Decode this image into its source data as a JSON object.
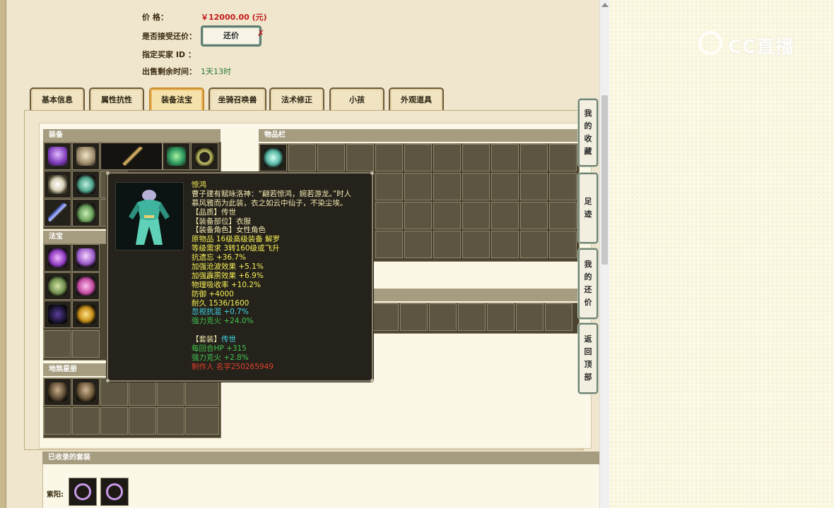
{
  "listing": {
    "price_label": "价        格：",
    "price_value": "￥12000.00 (元)",
    "accept_counter_label": "是否接受还价：",
    "counter_button": "还价",
    "counter_mark": "✗",
    "buyer_id_label": "指定买家 ID ：",
    "remaining_label": "出售剩余时间：",
    "remaining_value": "1天13时"
  },
  "tabs": [
    {
      "label": "基本信息"
    },
    {
      "label": "属性抗性"
    },
    {
      "label": "装备法宝"
    },
    {
      "label": "坐骑召唤兽"
    },
    {
      "label": "法术修正"
    },
    {
      "label": "小孩"
    },
    {
      "label": "外观道具"
    }
  ],
  "active_tab": "装备法宝",
  "sections": {
    "equipment": "装备",
    "inventory": "物品栏",
    "treasure": "法宝",
    "earth_star": "地煞星册",
    "collected_sets": "已收录的套装"
  },
  "collected_sets": {
    "row_label": "紫阳:"
  },
  "tooltip": {
    "name": "惊鸿",
    "lines": [
      {
        "text": "曹子建有赋咏洛神：“翩若惊鸿，婉若游龙。”时人",
        "color": "white"
      },
      {
        "text": "慕风雅而为此装，衣之如云中仙子，不染尘埃。",
        "color": "white"
      },
      {
        "text": "【品质】传世",
        "color": "white"
      },
      {
        "text": "【装备部位】衣服",
        "color": "white"
      },
      {
        "text": "【装备角色】女性角色",
        "color": "white"
      },
      {
        "text": "原物品 16级高级装备 解罗",
        "color": "yellow"
      },
      {
        "text": "等级需求 3转160级或飞升",
        "color": "yellow"
      },
      {
        "text": "抗遗忘 +36.7%",
        "color": "yellow"
      },
      {
        "text": "加强沧波效果 +5.1%",
        "color": "yellow"
      },
      {
        "text": "加强霹雳效果 +6.9%",
        "color": "yellow"
      },
      {
        "text": "物理吸收率 +10.2%",
        "color": "yellow"
      },
      {
        "text": "防御 +4000",
        "color": "yellow"
      },
      {
        "text": "耐久 1536/1600",
        "color": "yellow"
      },
      {
        "text": "忽视抗混 +0.7%",
        "color": "cyan"
      },
      {
        "text": "强力克火 +24.0%",
        "color": "green"
      },
      {
        "text": "",
        "color": "white"
      },
      {
        "text": "【套装】传世",
        "color": "mixed"
      },
      {
        "text": "每回合HP +315",
        "color": "green"
      },
      {
        "text": "强力克火 +2.8%",
        "color": "green"
      },
      {
        "text": "制作人 名字250265949",
        "color": "red"
      }
    ]
  },
  "side_buttons": [
    {
      "chars": [
        "我",
        "的",
        "收",
        "藏"
      ]
    },
    {
      "chars": [
        "足",
        "迹"
      ]
    },
    {
      "chars": [
        "我",
        "的",
        "还",
        "价"
      ]
    },
    {
      "chars": [
        "返",
        "回",
        "顶",
        "部"
      ]
    }
  ],
  "watermark": "CC直播",
  "icons": {
    "equipment_items": [
      "jellyfish-helm-icon",
      "skull-hat-icon",
      "whip-weapon-icon",
      "feather-mask-icon",
      "bead-necklace-icon",
      "white-flower-icon",
      "jade-dress-icon",
      "green-boots-icon",
      "sword-icon"
    ],
    "inventory_items": [
      "jade-bracelet-icon"
    ],
    "treasure_items": [
      "purple-cube-icon",
      "lantern-icon",
      "cactus-icon",
      "pink-lamp-icon",
      "dark-orb-icon",
      "golden-pillar-icon"
    ],
    "earth_star_items": [
      "warrior-portrait-icon",
      "monk-portrait-icon"
    ],
    "set_items": [
      "purple-ring-icon",
      "purple-ring-icon"
    ]
  },
  "colors": {
    "price": "#c41a1a",
    "remaining_time": "#2f7a3a",
    "active_tab_border": "#c98a2e",
    "tooltip_bg": "#25221b"
  }
}
